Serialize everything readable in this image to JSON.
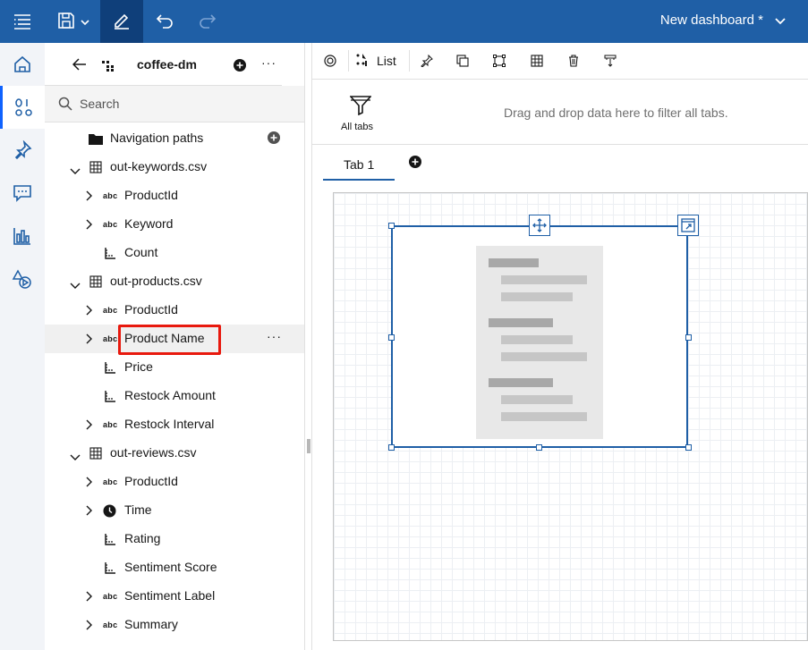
{
  "topbar": {
    "title": "New dashboard *",
    "icons": [
      "menu-icon",
      "save-icon",
      "chevron-down-icon",
      "edit-icon",
      "undo-icon",
      "redo-icon"
    ]
  },
  "rail": {
    "icons": [
      "home-icon",
      "data-sources-icon",
      "pin-icon",
      "chat-icon",
      "visualizations-icon",
      "widgets-icon"
    ]
  },
  "panel": {
    "source_name": "coffee-dm",
    "search_placeholder": "Search",
    "navigation_paths": "Navigation paths",
    "tree": [
      {
        "type": "table",
        "label": "out-keywords.csv",
        "children": [
          {
            "type": "abc",
            "label": "ProductId",
            "expandable": true
          },
          {
            "type": "abc",
            "label": "Keyword",
            "expandable": true
          },
          {
            "type": "measure",
            "label": "Count",
            "expandable": false
          }
        ]
      },
      {
        "type": "table",
        "label": "out-products.csv",
        "children": [
          {
            "type": "abc",
            "label": "ProductId",
            "expandable": true
          },
          {
            "type": "abc",
            "label": "Product Name",
            "expandable": true,
            "highlighted": true
          },
          {
            "type": "measure",
            "label": "Price",
            "expandable": false
          },
          {
            "type": "measure",
            "label": "Restock Amount",
            "expandable": false
          },
          {
            "type": "abc",
            "label": "Restock Interval",
            "expandable": true
          }
        ]
      },
      {
        "type": "table",
        "label": "out-reviews.csv",
        "children": [
          {
            "type": "abc",
            "label": "ProductId",
            "expandable": true
          },
          {
            "type": "time",
            "label": "Time",
            "expandable": true
          },
          {
            "type": "measure",
            "label": "Rating",
            "expandable": false
          },
          {
            "type": "measure",
            "label": "Sentiment Score",
            "expandable": false
          },
          {
            "type": "abc",
            "label": "Sentiment Label",
            "expandable": true
          },
          {
            "type": "abc",
            "label": "Summary",
            "expandable": true
          }
        ]
      }
    ],
    "abc": "abc",
    "overflow": "···"
  },
  "toolbar": {
    "list_label": "List"
  },
  "filters": {
    "all_tabs_label": "All tabs",
    "drop_hint": "Drag and drop data here to filter all tabs."
  },
  "tabs": {
    "tab1": "Tab 1"
  },
  "colors": {
    "brand": "#1f5fa6",
    "highlight_box": "#e8190e"
  }
}
